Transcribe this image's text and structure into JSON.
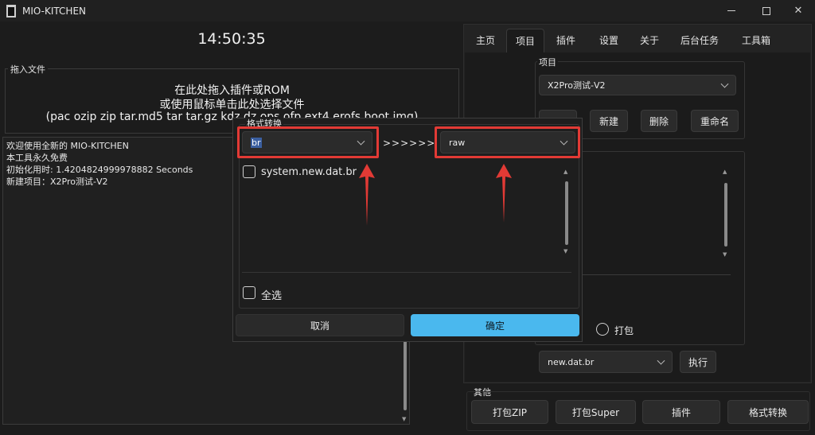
{
  "window": {
    "title": "MIO-KITCHEN"
  },
  "left": {
    "clock": "14:50:35",
    "drop_zone": {
      "label": "拖入文件",
      "lines": [
        "在此处拖入插件或ROM",
        "或使用鼠标单击此处选择文件",
        "(pac ozip zip tar.md5 tar tar.gz kdz dz ops ofp ext4 erofs boot img)"
      ]
    },
    "log": [
      "欢迎使用全新的 MIO-KITCHEN",
      "本工具永久免费",
      "初始化用时: 1.4204824999978882 Seconds",
      "新建项目：X2Pro测试-V2"
    ]
  },
  "right": {
    "tabs": [
      "主页",
      "项目",
      "插件",
      "设置",
      "关于",
      "后台任务",
      "工具箱"
    ],
    "active_tab": "项目",
    "project": {
      "label": "项目",
      "selected": "X2Pro测试-V2",
      "buttons": [
        "新建",
        "删除",
        "重命名"
      ]
    },
    "pack": {
      "radio_label": "打包",
      "format_select": "new.dat.br",
      "run_button": "执行"
    },
    "other": {
      "label": "其他",
      "buttons": [
        "打包ZIP",
        "打包Super",
        "插件",
        "格式转换"
      ]
    }
  },
  "dialog": {
    "title": "格式转换",
    "from_format": "br",
    "arrows": ">>>>>>",
    "to_format": "raw",
    "files": [
      {
        "name": "system.new.dat.br",
        "checked": false
      }
    ],
    "select_all": "全选",
    "cancel": "取消",
    "confirm": "确定",
    "colors": {
      "highlight": "#e23a35",
      "primary": "#4ab8ee"
    }
  }
}
